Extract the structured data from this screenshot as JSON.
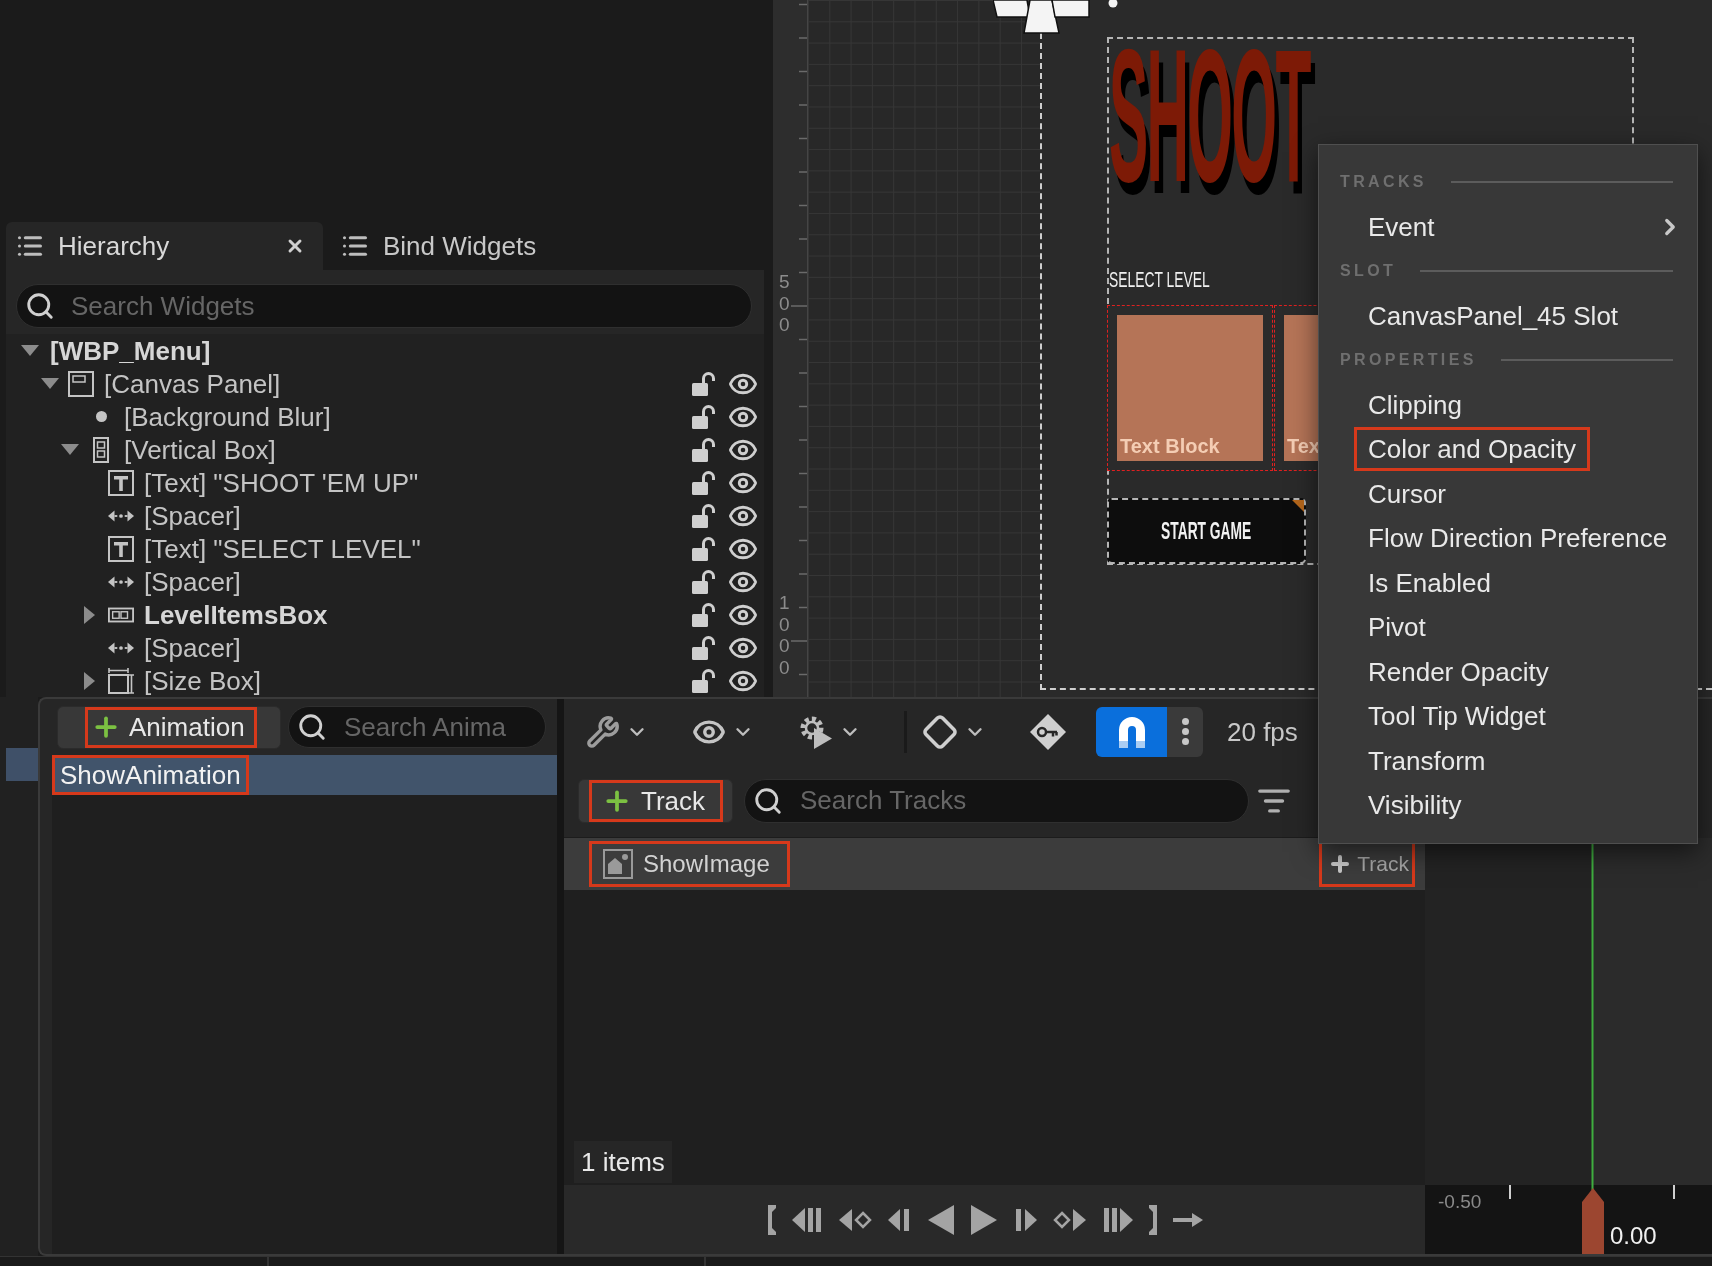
{
  "hierarchy": {
    "tabs": [
      {
        "label": "Hierarchy",
        "selected": true
      },
      {
        "label": "Bind Widgets",
        "selected": false
      }
    ],
    "search": {
      "placeholder": "Search Widgets"
    },
    "tree": [
      {
        "label": "[WBP_Menu]",
        "kind": "root",
        "bold": true,
        "expanded": true,
        "children": [
          {
            "label": "[Canvas Panel]",
            "kind": "canvas",
            "bold": false,
            "expanded": true,
            "locked": false,
            "visible": true,
            "children": [
              {
                "label": "[Background Blur]",
                "kind": "blur",
                "bold": false,
                "locked": false,
                "visible": true
              },
              {
                "label": "[Vertical Box]",
                "kind": "vertical-box",
                "bold": false,
                "expanded": true,
                "locked": false,
                "visible": true,
                "children": [
                  {
                    "label": "[Text] \"SHOOT 'EM UP\"",
                    "kind": "text",
                    "bold": false,
                    "locked": false,
                    "visible": true
                  },
                  {
                    "label": "[Spacer]",
                    "kind": "spacer",
                    "bold": false,
                    "locked": false,
                    "visible": true
                  },
                  {
                    "label": "[Text] \"SELECT LEVEL\"",
                    "kind": "text",
                    "bold": false,
                    "locked": false,
                    "visible": true
                  },
                  {
                    "label": "[Spacer]",
                    "kind": "spacer",
                    "bold": false,
                    "locked": false,
                    "visible": true
                  },
                  {
                    "label": "LevelItemsBox",
                    "kind": "horizontal-box",
                    "bold": true,
                    "expanded": false,
                    "locked": false,
                    "visible": true
                  },
                  {
                    "label": "[Spacer]",
                    "kind": "spacer",
                    "bold": false,
                    "locked": false,
                    "visible": true
                  },
                  {
                    "label": "[Size Box]",
                    "kind": "size-box",
                    "bold": false,
                    "expanded": false,
                    "locked": false,
                    "visible": true
                  }
                ]
              }
            ]
          }
        ]
      }
    ]
  },
  "designer": {
    "ruler_labels": [
      "500",
      "1000"
    ],
    "title": "SHOOT",
    "subtitle": "SELECT LEVEL",
    "level_cards": [
      {
        "label": "Text Block"
      },
      {
        "label": "Tex"
      }
    ],
    "start_button": "START GAME"
  },
  "context_menu": {
    "sections": [
      {
        "header": "TRACKS",
        "items": [
          {
            "label": "Event",
            "submenu": true,
            "highlighted": false
          }
        ]
      },
      {
        "header": "SLOT",
        "items": [
          {
            "label": "CanvasPanel_45 Slot",
            "submenu": false,
            "highlighted": false
          }
        ]
      },
      {
        "header": "PROPERTIES",
        "items": [
          {
            "label": "Clipping",
            "submenu": false,
            "highlighted": false
          },
          {
            "label": "Color and Opacity",
            "submenu": false,
            "highlighted": true
          },
          {
            "label": "Cursor",
            "submenu": false,
            "highlighted": false
          },
          {
            "label": "Flow Direction Preference",
            "submenu": false,
            "highlighted": false
          },
          {
            "label": "Is Enabled",
            "submenu": false,
            "highlighted": false
          },
          {
            "label": "Pivot",
            "submenu": false,
            "highlighted": false
          },
          {
            "label": "Render Opacity",
            "submenu": false,
            "highlighted": false
          },
          {
            "label": "Tool Tip Widget",
            "submenu": false,
            "highlighted": false
          },
          {
            "label": "Transform",
            "submenu": false,
            "highlighted": false
          },
          {
            "label": "Visibility",
            "submenu": false,
            "highlighted": false
          }
        ]
      }
    ]
  },
  "animations": {
    "add_button": {
      "label": "Animation",
      "highlighted": true
    },
    "search": {
      "placeholder": "Search Anima"
    },
    "items": [
      {
        "label": "ShowAnimation",
        "selected": true,
        "highlighted": true
      }
    ]
  },
  "sequencer": {
    "toolbar": {
      "snap_on": true,
      "frame_rate": "20 fps"
    },
    "add_track": {
      "label": "Track",
      "highlighted": true
    },
    "search": {
      "placeholder": "Search Tracks"
    },
    "tracks": [
      {
        "label": "ShowImage",
        "highlighted": true,
        "add_button": {
          "label": "Track",
          "highlighted": true
        }
      }
    ],
    "item_count": "1 items"
  },
  "timeline": {
    "range_start": "-0.50",
    "current_time": "0.00"
  }
}
